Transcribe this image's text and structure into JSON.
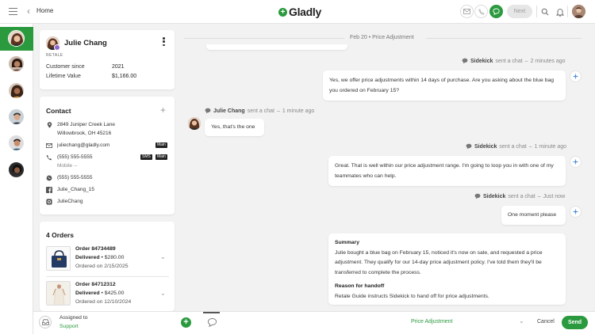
{
  "topbar": {
    "home_label": "Home",
    "logo_text": "Gladly",
    "next_label": "Next",
    "icons": [
      "hamburger-icon",
      "back-chevron-icon",
      "email-channel-icon",
      "phone-channel-icon",
      "chat-channel-icon",
      "search-icon",
      "bell-icon"
    ]
  },
  "colors": {
    "accent": "#2b9a3e",
    "badge_purple": "#9065d0",
    "background": "#f2f2f2"
  },
  "customer": {
    "name": "Julie Chang",
    "tag": "RETALE",
    "customer_since_label": "Customer since",
    "customer_since_value": "2021",
    "lifetime_value_label": "Lifetime Value",
    "lifetime_value_value": "$1,166.00"
  },
  "contact": {
    "title": "Contact",
    "address_line1": "2849 Juniper Creek Lane",
    "address_line2": "Willowbrook, OH 45216",
    "email": "juliechang@gladly.com",
    "email_tag": "Main",
    "phone": "(555) 555-5555",
    "phone_tag_sms": "SMS",
    "phone_tag_main": "Main",
    "phone_type": "Mobile",
    "phone_dash": "--",
    "whatsapp": "(555) 555-5555",
    "facebook": "Julie_Chang_15",
    "instagram": "JulieChang"
  },
  "orders": {
    "title": "4 Orders",
    "items": [
      {
        "order_label": "Order",
        "number": "84734489",
        "status": "Delivered",
        "price": "$280.00",
        "date_text": "Ordered on 2/15/2025"
      },
      {
        "order_label": "Order",
        "number": "84712312",
        "status": "Delivered",
        "price": "$425.00",
        "date_text": "Ordered on 12/10/2024"
      }
    ]
  },
  "conversation": {
    "date_separator": "Feb 20 • Price Adjustment",
    "messages": [
      {
        "author": "Sidekick",
        "verb": "sent a chat",
        "time": "2 minutes ago",
        "text": "Yes, we offer price adjustments within 14 days of purchase. Are you asking about the blue bag you ordered on February 15?"
      },
      {
        "author": "Julie Chang",
        "verb": "sent a chat",
        "time": "1 minute ago",
        "text": "Yes, that's the one"
      },
      {
        "author": "Sidekick",
        "verb": "sent a chat",
        "time": "1 minute ago",
        "text": "Great. That is well within our price adjustment range. I'm going to loop you in with one of my teammates who can help."
      },
      {
        "author": "Sidekick",
        "verb": "sent a chat",
        "time": "Just now",
        "text": "One moment please"
      }
    ],
    "summary": {
      "heading": "Summary",
      "text": "Julie bought a blue bag on February 15, noticed it's now on sale, and requested a price adjustment. They qualify for our 14-day price adjustment policy. I've told them they'll be transferred to complete the process.",
      "handoff_heading": "Reason for handoff",
      "handoff_text": "Retale Guide instructs Sidekick to hand off for price adjustments."
    },
    "separator_dash": "—"
  },
  "composer": {
    "assigned_label": "Assigned to",
    "assigned_value": "Support",
    "reply_select": "Price Adjustment",
    "cancel_label": "Cancel",
    "send_label": "Send"
  }
}
